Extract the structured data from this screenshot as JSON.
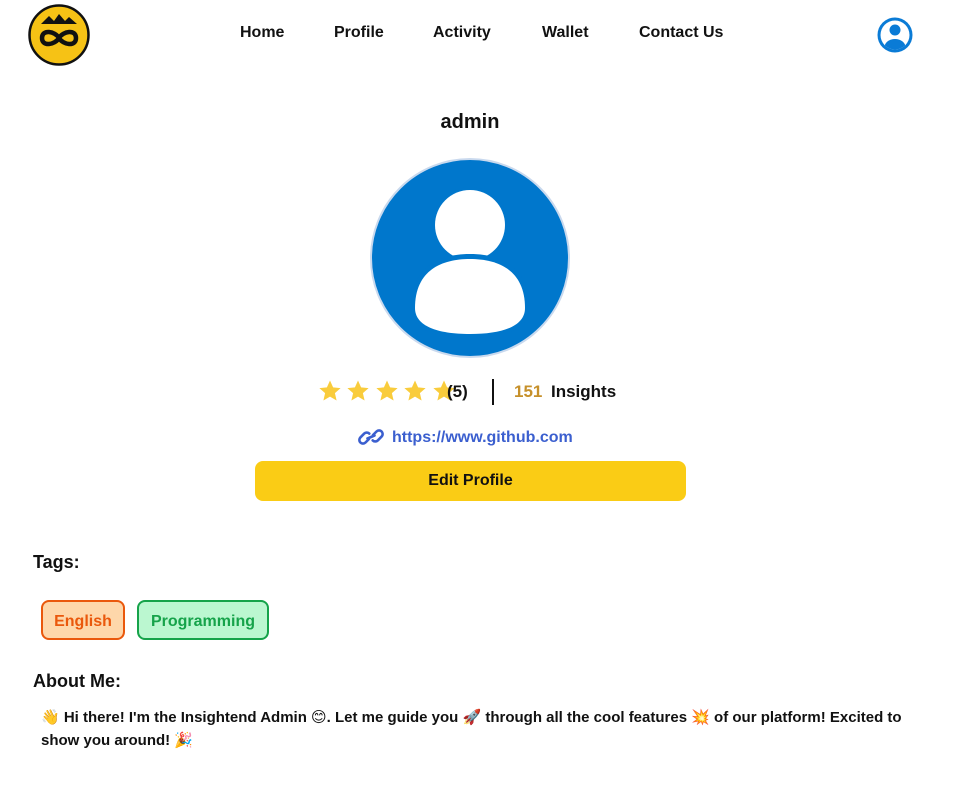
{
  "nav": {
    "items": [
      {
        "label": "Home"
      },
      {
        "label": "Profile"
      },
      {
        "label": "Activity"
      },
      {
        "label": "Wallet"
      },
      {
        "label": "Contact Us"
      }
    ]
  },
  "icons": {
    "logo": "infinity-mountain-logo",
    "user": "user-account-icon",
    "avatar": "default-avatar-icon",
    "star": "star-icon",
    "link": "link-icon"
  },
  "profile": {
    "username": "admin",
    "rating_value": 5,
    "rating_max": 5,
    "rating_count": "(5)",
    "insights_count": "151",
    "insights_label": "Insights",
    "website": "https://www.github.com",
    "edit_label": "Edit Profile"
  },
  "tags_section": {
    "title": "Tags:",
    "tags": [
      {
        "label": "English"
      },
      {
        "label": "Programming"
      }
    ]
  },
  "about_section": {
    "title": "About Me:",
    "text": "👋 Hi there! I'm the Insightend Admin 😊. Let me guide you 🚀 through all the cool features 💥 of our platform! Excited to show you around! 🎉"
  },
  "colors": {
    "accent_yellow": "#facc15",
    "avatar_blue": "#0077cc",
    "insights_gold": "#c6902a",
    "link_blue": "#3b5fcf",
    "english_tag": "#ea580c",
    "programming_tag": "#16a34a",
    "star": "#f9cc3c"
  }
}
